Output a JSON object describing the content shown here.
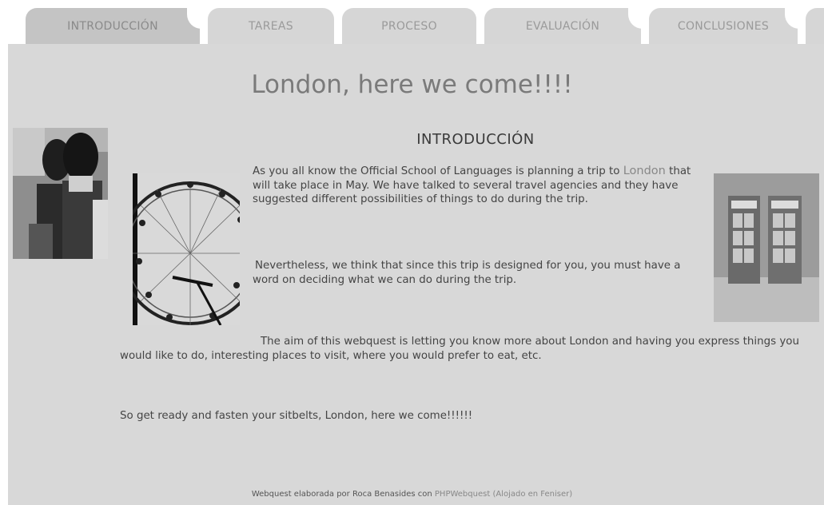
{
  "tabs": [
    {
      "label": "INTRODUCCIÓN",
      "active": true
    },
    {
      "label": "TAREAS",
      "active": false
    },
    {
      "label": "PROCESO",
      "active": false
    },
    {
      "label": "EVALUACIÓN",
      "active": false
    },
    {
      "label": "CONCLUSIONES",
      "active": false
    }
  ],
  "page": {
    "title": "London, here we come!!!!",
    "section_heading": "INTRODUCCIÓN",
    "p1_before": "As you all know the Official School of Languages is planning a trip to ",
    "p1_link": "London",
    "p1_after": " that will take place in May. We have talked to several travel agencies and they have suggested different possibilities of things to do during the trip.",
    "p2": "Nevertheless, we think that since this trip is designed for you, you must have a word on deciding what we can do during the trip.",
    "p3": "The aim of this webquest is letting you know more about London and having you express things you would like to do, interesting places to visit, where you would prefer to eat, etc.",
    "p4": "So get ready and fasten your sitbelts, London, here we come!!!!!!"
  },
  "footer": {
    "text": "Webquest elaborada por Roca Benasides con",
    "link": "PHPWebquest",
    "hosted": "(Alojado en Feniser)"
  },
  "colors": {
    "panel": "#d8d8d8",
    "tab": "#d6d6d6",
    "tab_active": "#c4c4c4"
  }
}
